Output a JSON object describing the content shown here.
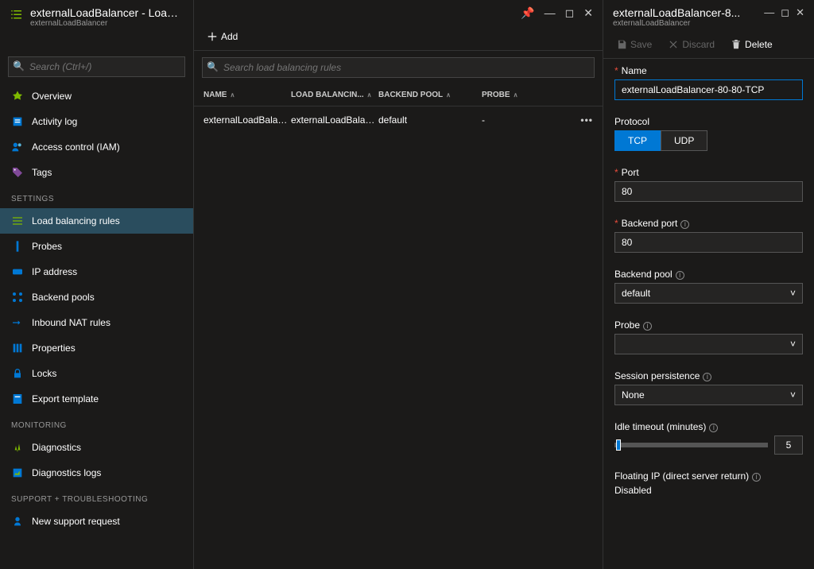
{
  "pageTitle": "externalLoadBalancer - Load balancing rules",
  "pageSubtitle": "externalLoadBalancer",
  "search": {
    "placeholder": "Search (Ctrl+/)"
  },
  "nav": {
    "overview": "Overview",
    "activity": "Activity log",
    "iam": "Access control (IAM)",
    "tags": "Tags",
    "settingsHdr": "SETTINGS",
    "lbr": "Load balancing rules",
    "probes": "Probes",
    "ip": "IP address",
    "backend": "Backend pools",
    "nat": "Inbound NAT rules",
    "props": "Properties",
    "locks": "Locks",
    "export": "Export template",
    "monHdr": "MONITORING",
    "diag": "Diagnostics",
    "diaglogs": "Diagnostics logs",
    "supportHdr": "SUPPORT + TROUBLESHOOTING",
    "newreq": "New support request"
  },
  "toolbar": {
    "add": "Add"
  },
  "rulesSearch": {
    "placeholder": "Search load balancing rules"
  },
  "tableHeaders": {
    "name": "NAME",
    "lb": "LOAD BALANCIN...",
    "bp": "BACKEND POOL",
    "probe": "PROBE"
  },
  "rows": [
    {
      "name": "externalLoadBalance...",
      "lb": "externalLoadBalanc...",
      "bp": "default",
      "probe": "-"
    }
  ],
  "detail": {
    "title": "externalLoadBalancer-8...",
    "subtitle": "externalLoadBalancer",
    "save": "Save",
    "discard": "Discard",
    "delete": "Delete",
    "nameLabel": "Name",
    "nameValue": "externalLoadBalancer-80-80-TCP",
    "protocolLabel": "Protocol",
    "tcp": "TCP",
    "udp": "UDP",
    "portLabel": "Port",
    "portValue": "80",
    "backendPortLabel": "Backend port",
    "backendPortValue": "80",
    "backendPoolLabel": "Backend pool",
    "backendPoolValue": "default",
    "probeLabel": "Probe",
    "probeValue": "",
    "sessionLabel": "Session persistence",
    "sessionValue": "None",
    "idleLabel": "Idle timeout (minutes)",
    "idleValue": "5",
    "floatingLabel": "Floating IP (direct server return)",
    "floatingValue": "Disabled"
  }
}
